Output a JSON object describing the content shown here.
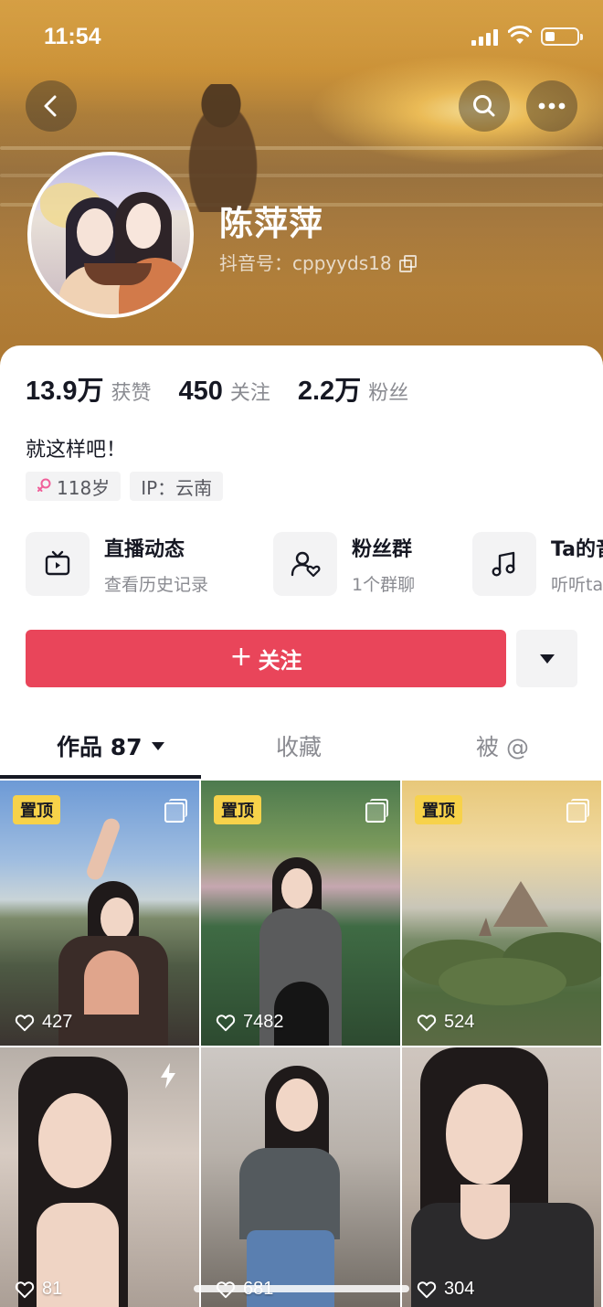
{
  "status_bar": {
    "time": "11:54"
  },
  "profile": {
    "nickname": "陈萍萍",
    "douyin_id": "抖音号：cppyyds18"
  },
  "stats": [
    {
      "value": "13.9万",
      "label": "获赞"
    },
    {
      "value": "450",
      "label": "关注"
    },
    {
      "value": "2.2万",
      "label": "粉丝"
    }
  ],
  "bio": "就这样吧！",
  "tags": {
    "age": "118岁",
    "ip": "IP：云南"
  },
  "features": [
    {
      "title": "直播动态",
      "subtitle": "查看历史记录",
      "icon": "tv-icon"
    },
    {
      "title": "粉丝群",
      "subtitle": "1个群聊",
      "icon": "fan-group-icon"
    },
    {
      "title": "Ta的音乐",
      "subtitle": "听听ta",
      "icon": "music-icon"
    }
  ],
  "actions": {
    "follow_label": "关注",
    "follow_plus": "+"
  },
  "tabs": [
    {
      "label": "作品 87",
      "active": true
    },
    {
      "label": "收藏",
      "active": false
    },
    {
      "label": "被 @",
      "active": false
    }
  ],
  "videos": [
    {
      "pinned": true,
      "pin_label": "置顶",
      "multi": true,
      "likes": "427"
    },
    {
      "pinned": true,
      "pin_label": "置顶",
      "multi": true,
      "likes": "7482"
    },
    {
      "pinned": true,
      "pin_label": "置顶",
      "multi": true,
      "likes": "524"
    },
    {
      "pinned": false,
      "bolt": true,
      "likes": "81"
    },
    {
      "pinned": false,
      "likes": "681"
    },
    {
      "pinned": false,
      "likes": "304"
    }
  ],
  "colors": {
    "accent": "#e9455a",
    "pin": "#f7d24a",
    "text": "#161823",
    "muted": "#8a8b91"
  }
}
